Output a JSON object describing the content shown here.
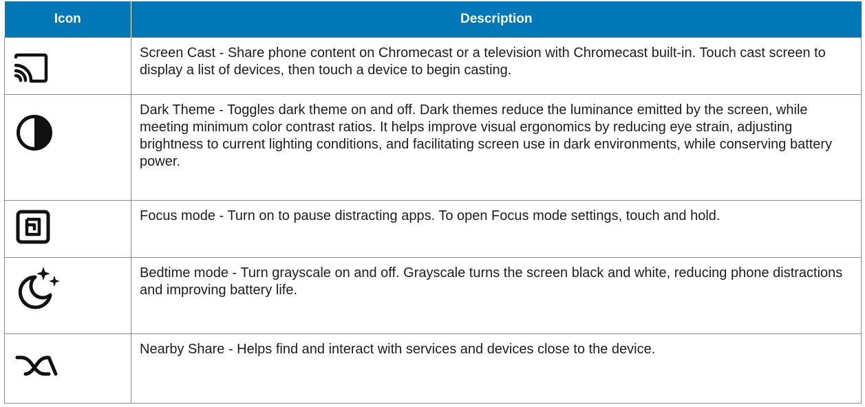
{
  "table": {
    "headers": {
      "icon": "Icon",
      "description": "Description"
    },
    "rows": [
      {
        "icon": "screen-cast-icon",
        "description": "Screen Cast - Share phone content on Chromecast or a television with Chromecast built-in. Touch cast screen to display a list of devices, then touch a device to begin casting."
      },
      {
        "icon": "dark-theme-icon",
        "description": "Dark Theme - Toggles dark theme on and off. Dark themes reduce the luminance emitted by the screen, while meeting minimum color contrast ratios. It helps improve visual ergonomics by reducing eye strain, adjusting brightness to current lighting conditions, and facilitating screen use in dark environments, while conserving battery power."
      },
      {
        "icon": "focus-mode-icon",
        "description": "Focus mode - Turn on to pause distracting apps. To open Focus mode settings, touch and hold."
      },
      {
        "icon": "bedtime-mode-icon",
        "description": "Bedtime mode - Turn grayscale on and off. Grayscale turns the screen black and white, reducing phone distractions and improving battery life."
      },
      {
        "icon": "nearby-share-icon",
        "description": "Nearby Share - Helps find and interact with services and devices close to the device."
      }
    ]
  },
  "colors": {
    "header_background": "#0077b6",
    "header_text": "#ffffff",
    "border": "#8a8a8a",
    "icon": "#111111"
  }
}
